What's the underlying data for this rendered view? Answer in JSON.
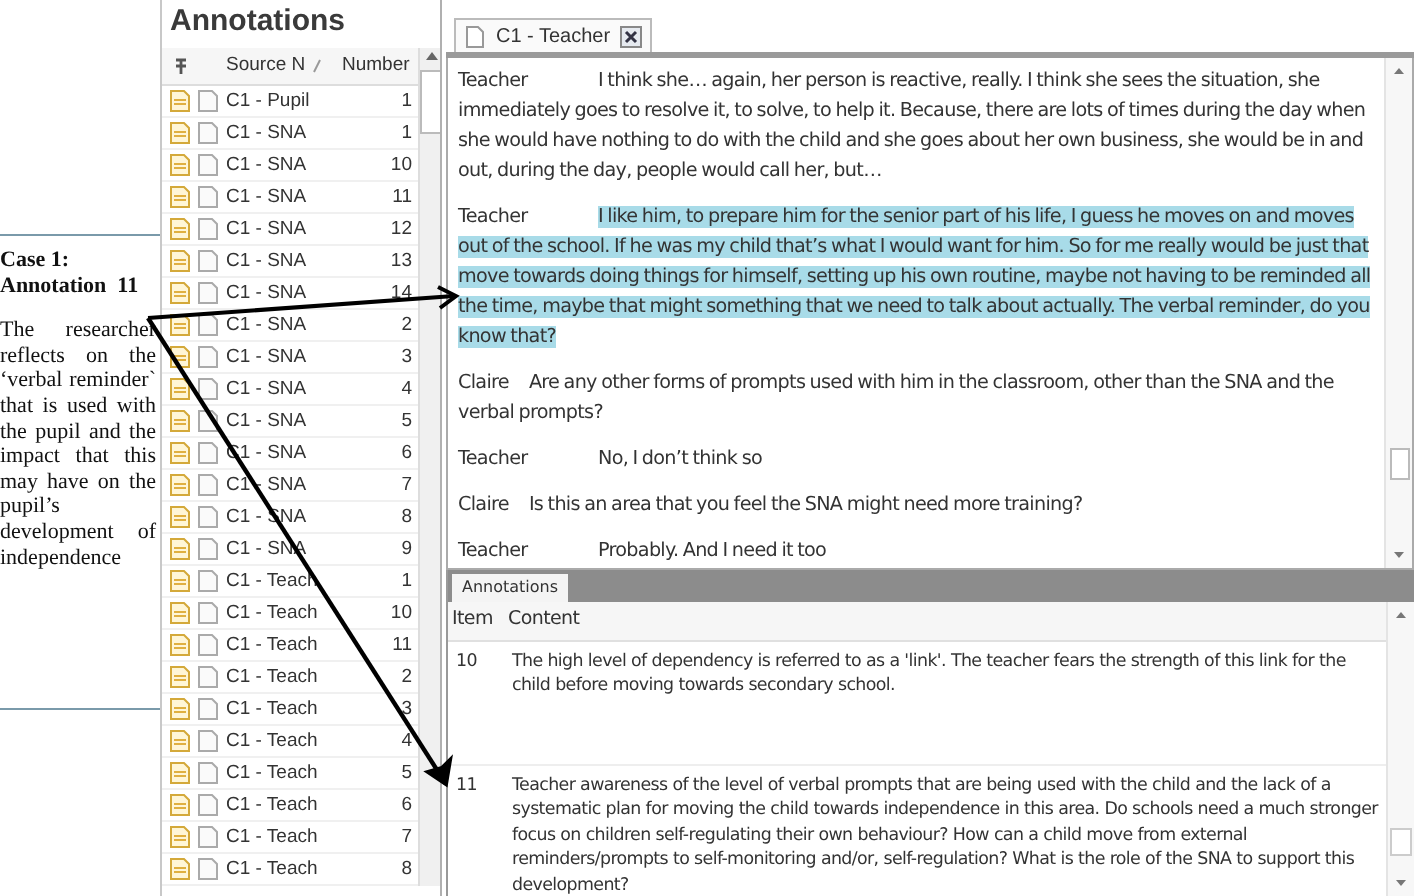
{
  "callout": {
    "heading": [
      "Case 1:",
      "Annotation  11"
    ],
    "body": "The researcher reflects on the ‘verbal reminder` that is used with the pupil and the impact that this may have on the pupil’s development of independence"
  },
  "annotation_list": {
    "title": "Annotations",
    "columns": [
      "Source N",
      "Number"
    ],
    "rows": [
      {
        "source": "C1 -  Pupil",
        "number": "1"
      },
      {
        "source": "C1 - SNA",
        "number": "1"
      },
      {
        "source": "C1 - SNA",
        "number": "10"
      },
      {
        "source": "C1 - SNA",
        "number": "11"
      },
      {
        "source": "C1 - SNA",
        "number": "12"
      },
      {
        "source": "C1 - SNA",
        "number": "13"
      },
      {
        "source": "C1 - SNA",
        "number": "14"
      },
      {
        "source": "C1 - SNA",
        "number": "2"
      },
      {
        "source": "C1 - SNA",
        "number": "3"
      },
      {
        "source": "C1 - SNA",
        "number": "4"
      },
      {
        "source": "C1 - SNA",
        "number": "5"
      },
      {
        "source": "C1 - SNA",
        "number": "6"
      },
      {
        "source": "C1 - SNA",
        "number": "7"
      },
      {
        "source": "C1 - SNA",
        "number": "8"
      },
      {
        "source": "C1 - SNA",
        "number": "9"
      },
      {
        "source": "C1 - Teach",
        "number": "1"
      },
      {
        "source": "C1 - Teach",
        "number": "10"
      },
      {
        "source": "C1 - Teach",
        "number": "11"
      },
      {
        "source": "C1 - Teach",
        "number": "2"
      },
      {
        "source": "C1 - Teach",
        "number": "3"
      },
      {
        "source": "C1 - Teach",
        "number": "4"
      },
      {
        "source": "C1 - Teach",
        "number": "5"
      },
      {
        "source": "C1 - Teach",
        "number": "6"
      },
      {
        "source": "C1 - Teach",
        "number": "7"
      },
      {
        "source": "C1 - Teach",
        "number": "8"
      }
    ]
  },
  "document": {
    "tab": "C1 - Teacher",
    "paragraphs": [
      {
        "speaker": "Teacher",
        "kind": "respondent",
        "selected": false,
        "text": "I think she… again, her person is reactive, really. I think she sees the situation, she immediately goes to resolve it, to solve, to help it. Because, there are lots of times during the day when she would have nothing to do with the child and she goes about her own business, she would be in and out, during the day, people would call her, but…"
      },
      {
        "speaker": "Teacher",
        "kind": "respondent",
        "selected": true,
        "text": "I like him, to prepare him for the senior part of his life, I guess he moves on and moves out of the school. If he was my child that’s what I would want for him. So for me really would be just that move towards doing things for himself, setting up his own routine, maybe not having to be reminded all the time, maybe that might something that we need to talk about actually. The verbal reminder, do you know that?"
      },
      {
        "speaker": "Claire",
        "kind": "interviewer",
        "selected": false,
        "text": "Are any other forms of prompts used with him in the classroom, other than the SNA and the verbal prompts?"
      },
      {
        "speaker": "Teacher",
        "kind": "respondent",
        "selected": false,
        "text": "No, I don’t think so"
      },
      {
        "speaker": "Claire",
        "kind": "interviewer",
        "selected": false,
        "text": "Is this an area that you feel the SNA might need more training?"
      },
      {
        "speaker": "Teacher",
        "kind": "respondent",
        "selected": false,
        "text": "Probably. And I need it too"
      }
    ]
  },
  "annotations_pane": {
    "tab": "Annotations",
    "columns": [
      "Item",
      "Content"
    ],
    "items": [
      {
        "item": "10",
        "content": "The high level of dependency is referred to as a 'link'. The teacher fears the strength of this link for the child before moving towards secondary school."
      },
      {
        "item": "11",
        "content": "Teacher awareness of the level of verbal prompts that are being used with the child and the lack of a systematic plan for moving the child towards independence in this area. Do schools need a much stronger focus on children self-regulating their own behaviour? How can a child move from external reminders/prompts to self-monitoring and/or, self-regulation? What is the role of the SNA to support this development?"
      }
    ]
  }
}
